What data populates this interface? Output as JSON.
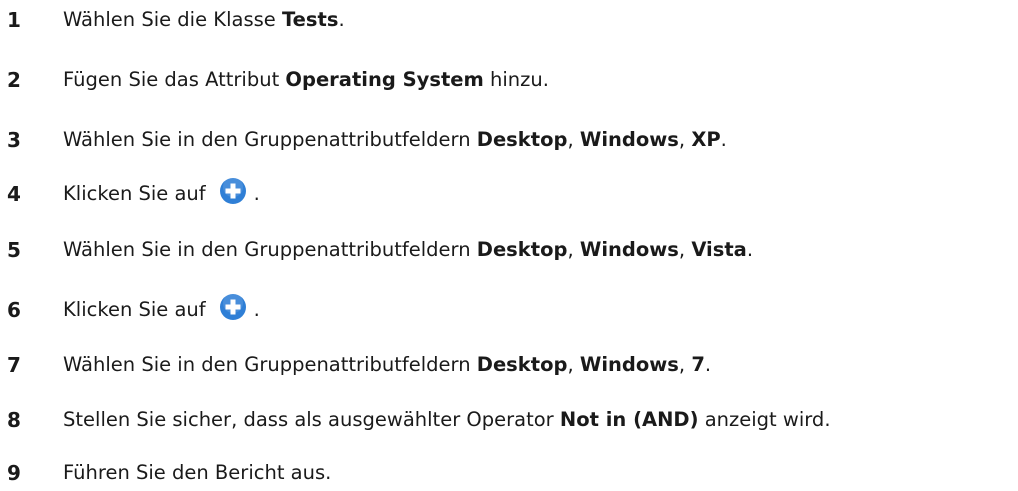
{
  "steps": [
    {
      "num": "1",
      "parts": [
        {
          "t": "Wählen Sie die Klasse "
        },
        {
          "t": "Tests",
          "b": true
        },
        {
          "t": "."
        }
      ]
    },
    {
      "num": "2",
      "parts": [
        {
          "t": "Fügen Sie das Attribut "
        },
        {
          "t": "Operating System",
          "b": true
        },
        {
          "t": " hinzu."
        }
      ]
    },
    {
      "num": "3",
      "parts": [
        {
          "t": "Wählen Sie in den Gruppenattributfeldern "
        },
        {
          "t": "Desktop",
          "b": true
        },
        {
          "t": ", "
        },
        {
          "t": "Windows",
          "b": true
        },
        {
          "t": ", "
        },
        {
          "t": "XP",
          "b": true
        },
        {
          "t": "."
        }
      ]
    },
    {
      "num": "4",
      "parts": [
        {
          "t": "Klicken Sie auf"
        },
        {
          "icon": "plus-circle-icon"
        },
        {
          "t": "."
        }
      ]
    },
    {
      "num": "5",
      "parts": [
        {
          "t": "Wählen Sie in den Gruppenattributfeldern "
        },
        {
          "t": "Desktop",
          "b": true
        },
        {
          "t": ", "
        },
        {
          "t": "Windows",
          "b": true
        },
        {
          "t": ", "
        },
        {
          "t": "Vista",
          "b": true
        },
        {
          "t": "."
        }
      ]
    },
    {
      "num": "6",
      "parts": [
        {
          "t": "Klicken Sie auf"
        },
        {
          "icon": "plus-circle-icon"
        },
        {
          "t": "."
        }
      ]
    },
    {
      "num": "7",
      "parts": [
        {
          "t": "Wählen Sie in den Gruppenattributfeldern "
        },
        {
          "t": "Desktop",
          "b": true
        },
        {
          "t": ", "
        },
        {
          "t": "Windows",
          "b": true
        },
        {
          "t": ", "
        },
        {
          "t": "7",
          "b": true
        },
        {
          "t": "."
        }
      ]
    },
    {
      "num": "8",
      "parts": [
        {
          "t": "Stellen Sie sicher, dass als ausgewählter Operator "
        },
        {
          "t": "Not in (AND)",
          "b": true
        },
        {
          "t": " anzeigt wird."
        }
      ]
    },
    {
      "num": "9",
      "parts": [
        {
          "t": "Führen Sie den Bericht aus."
        }
      ]
    }
  ],
  "colors": {
    "text": "#1a1a1a",
    "icon_fill": "#2f7fd6",
    "icon_glyph": "#ffffff"
  }
}
